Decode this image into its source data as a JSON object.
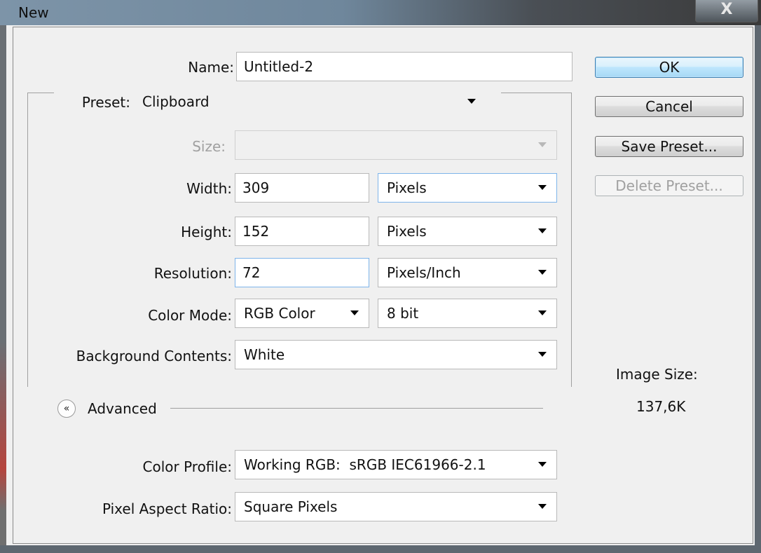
{
  "window": {
    "title": "New",
    "close_label": "X"
  },
  "form": {
    "name": {
      "label": "Name:",
      "value": "Untitled-2"
    },
    "preset": {
      "label": "Preset:",
      "value": "Clipboard"
    },
    "size": {
      "label": "Size:",
      "value": ""
    },
    "width": {
      "label": "Width:",
      "value": "309",
      "unit": "Pixels"
    },
    "height": {
      "label": "Height:",
      "value": "152",
      "unit": "Pixels"
    },
    "resolution": {
      "label": "Resolution:",
      "value": "72",
      "unit": "Pixels/Inch"
    },
    "color_mode": {
      "label": "Color Mode:",
      "value": "RGB Color",
      "bit_depth": "8 bit"
    },
    "background": {
      "label": "Background Contents:",
      "value": "White"
    },
    "advanced": {
      "label": "Advanced",
      "expander_glyph": "«"
    },
    "color_profile": {
      "label": "Color Profile:",
      "value": "Working RGB:  sRGB IEC61966-2.1"
    },
    "pixel_aspect": {
      "label": "Pixel Aspect Ratio:",
      "value": "Square Pixels"
    }
  },
  "buttons": {
    "ok": "OK",
    "cancel": "Cancel",
    "save_preset": "Save Preset...",
    "delete_preset": "Delete Preset..."
  },
  "image_size": {
    "label": "Image Size:",
    "value": "137,6K"
  },
  "colors": {
    "focus_border": "#7eb4ea",
    "default_button": "#bee6fd",
    "disabled_text": "#a0a0a0"
  }
}
